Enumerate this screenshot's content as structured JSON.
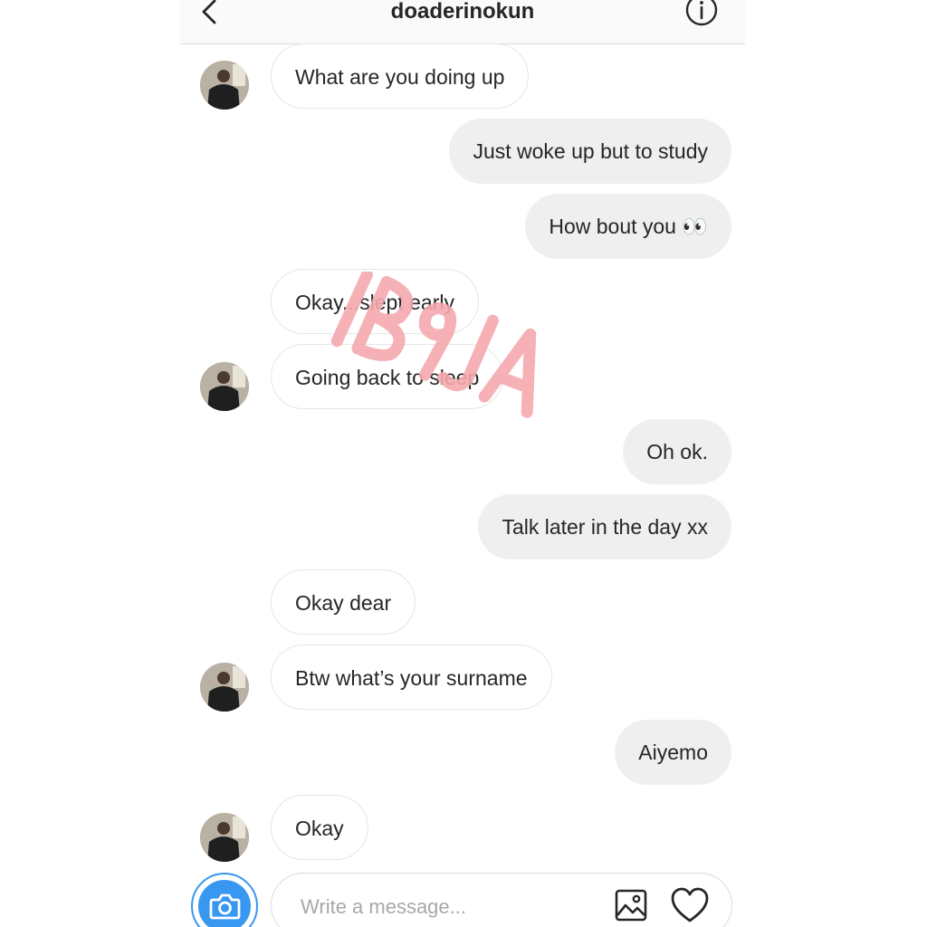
{
  "header": {
    "title": "doaderinokun",
    "back_icon": "chevron-left-icon",
    "info_icon": "info-icon"
  },
  "messages": [
    {
      "side": "in",
      "text": "What are you doing up",
      "avatar": true
    },
    {
      "side": "out",
      "text": "Just woke up but to study"
    },
    {
      "side": "out",
      "text": "How bout you 👀"
    },
    {
      "side": "in",
      "text": "Okay...slept early",
      "avatar": false
    },
    {
      "side": "in",
      "text": "Going back to sleep",
      "avatar": true
    },
    {
      "side": "out",
      "text": "Oh ok."
    },
    {
      "side": "out",
      "text": "Talk later in the day xx"
    },
    {
      "side": "in",
      "text": "Okay dear",
      "avatar": false
    },
    {
      "side": "in",
      "text": "Btw what’s your surname",
      "avatar": true
    },
    {
      "side": "out",
      "text": "Aiyemo"
    },
    {
      "side": "in",
      "text": "Okay",
      "avatar": true
    }
  ],
  "composer": {
    "placeholder": "Write a message...",
    "camera_icon": "camera-icon",
    "gallery_icon": "image-icon",
    "like_icon": "heart-icon"
  },
  "watermark": {
    "text": "IB9JA",
    "color": "#f4a9ae"
  },
  "colors": {
    "accent": "#3897f0",
    "outgoing_bubble": "#efefef",
    "incoming_border": "#e6e6e6"
  }
}
